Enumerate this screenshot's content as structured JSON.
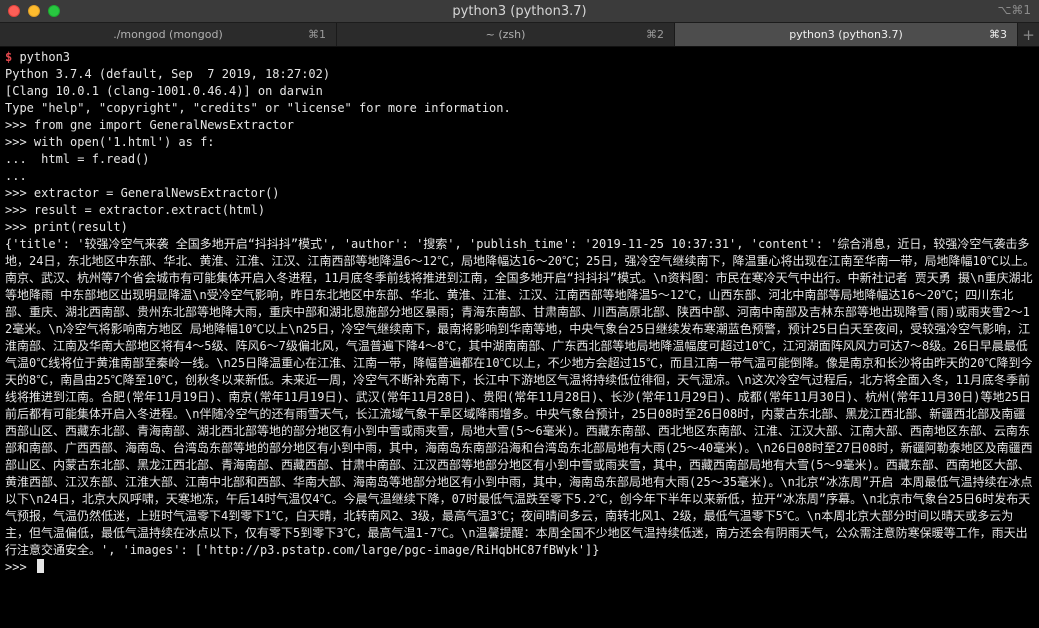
{
  "window": {
    "title": "python3 (python3.7)",
    "shortcut": "⌥⌘1"
  },
  "tabs": [
    {
      "label": "./mongod (mongod)",
      "shortcut": "⌘1"
    },
    {
      "label": "~ (zsh)",
      "shortcut": "⌘2"
    },
    {
      "label": "python3 (python3.7)",
      "shortcut": "⌘3"
    }
  ],
  "tab_add": "+",
  "terminal": {
    "shell_prompt": "$",
    "shell_command": " python3",
    "lines": [
      "Python 3.7.4 (default, Sep  7 2019, 18:27:02)",
      "[Clang 10.0.1 (clang-1001.0.46.4)] on darwin",
      "Type \"help\", \"copyright\", \"credits\" or \"license\" for more information.",
      ">>> from gne import GeneralNewsExtractor",
      ">>> with open('1.html') as f:",
      "...  html = f.read()",
      "...",
      ">>> extractor = GeneralNewsExtractor()",
      ">>> result = extractor.extract(html)",
      ">>> print(result)"
    ],
    "output": "{'title': '较强冷空气来袭 全国多地开启“抖抖抖”模式', 'author': '搜索', 'publish_time': '2019-11-25 10:37:31', 'content': '综合消息，近日，较强冷空气袭击多地，24日，东北地区中东部、华北、黄淮、江淮、江汉、江南西部等地降温6～12℃，局地降幅达16～20℃；25日，强冷空气继续南下，降温重心将出现在江南至华南一带，局地降幅10℃以上。南京、武汉、杭州等7个省会城市有可能集体开启入冬进程，11月底冬季前线将推进到江南，全国多地开启“抖抖抖”模式。\\n资料图：市民在寒冷天气中出行。中新社记者 贾天勇 摄\\n重庆湖北等地降雨 中东部地区出现明显降温\\n受冷空气影响，昨日东北地区中东部、华北、黄淮、江淮、江汉、江南西部等地降温5～12℃，山西东部、河北中南部等局地降幅达16～20℃；四川东北部、重庆、湖北西南部、贵州东北部等地降大雨，重庆中部和湖北恩施部分地区暴雨；青海东南部、甘肃南部、川西高原北部、陕西中部、河南中南部及吉林东部等地出现降雪(雨)或雨夹雪2～12毫米。\\n冷空气将影响南方地区 局地降幅10℃以上\\n25日，冷空气继续南下，最南将影响到华南等地，中央气象台25日继续发布寒潮蓝色预警，预计25日白天至夜间，受较强冷空气影响，江淮南部、江南及华南大部地区将有4～5级、阵风6～7级偏北风，气温普遍下降4～8℃，其中湖南南部、广东西北部等地局地降温幅度可超过10℃，江河湖面阵风风力可达7～8级。26日早晨最低气温0℃线将位于黄淮南部至秦岭一线。\\n25日降温重心在江淮、江南一带，降幅普遍都在10℃以上，不少地方会超过15℃，而且江南一带气温可能倒降。像是南京和长沙将由昨天的20℃降到今天的8℃，南昌由25℃降至10℃，创秋冬以来新低。未来近一周，冷空气不断补充南下，长江中下游地区气温将持续低位徘徊，天气湿凉。\\n这次冷空气过程后，北方将全面入冬，11月底冬季前线将推进到江南。合肥(常年11月19日)、南京(常年11月19日)、武汉(常年11月28日)、贵阳(常年11月28日)、长沙(常年11月29日)、成都(常年11月30日)、杭州(常年11月30日)等地25日前后都有可能集体开启入冬进程。\\n伴随冷空气的还有雨雪天气，长江流域气象干旱区域降雨增多。中央气象台预计，25日08时至26日08时，内蒙古东北部、黑龙江西北部、新疆西北部及南疆西部山区、西藏东北部、青海南部、湖北西北部等地的部分地区有小到中雪或雨夹雪，局地大雪(5～6毫米)。西藏东南部、西北地区东南部、江淮、江汉大部、江南大部、西南地区东部、云南东部和南部、广西西部、海南岛、台湾岛东部等地的部分地区有小到中雨，其中，海南岛东南部沿海和台湾岛东北部局地有大雨(25～40毫米)。\\n26日08时至27日08时，新疆阿勒泰地区及南疆西部山区、内蒙古东北部、黑龙江西北部、青海南部、西藏西部、甘肃中南部、江汉西部等地部分地区有小到中雪或雨夹雪，其中，西藏西南部局地有大雪(5～9毫米)。西藏东部、西南地区大部、黄淮西部、江汉东部、江淮大部、江南中北部和西部、华南大部、海南岛等地部分地区有小到中雨，其中，海南岛东部局地有大雨(25～35毫米)。\\n北京“冰冻周”开启 本周最低气温持续在冰点以下\\n24日，北京大风呼啸，天寒地冻，午后14时气温仅4℃。今晨气温继续下降，07时最低气温跌至零下5.2℃，创今年下半年以来新低，拉开“冰冻周”序幕。\\n北京市气象台25日6时发布天气预报，气温仍然低迷，上班时气温零下4到零下1℃，白天晴，北转南风2、3级，最高气温3℃；夜间晴间多云，南转北风1、2级，最低气温零下5℃。\\n本周北京大部分时间以晴天或多云为主，但气温偏低，最低气温持续在冰点以下，仅有零下5到零下3℃，最高气温1-7℃。\\n温馨提醒：本周全国不少地区气温持续低迷，南方还会有阴雨天气，公众需注意防寒保暖等工作，雨天出行注意交通安全。', 'images': ['http://p3.pstatp.com/large/pgc-image/RiHqbHC87fBWyk']}",
    "final_prompt": ">>> "
  },
  "colors": {
    "prompt": "#e5484d",
    "text": "#e6e6e6",
    "background": "#000000"
  }
}
